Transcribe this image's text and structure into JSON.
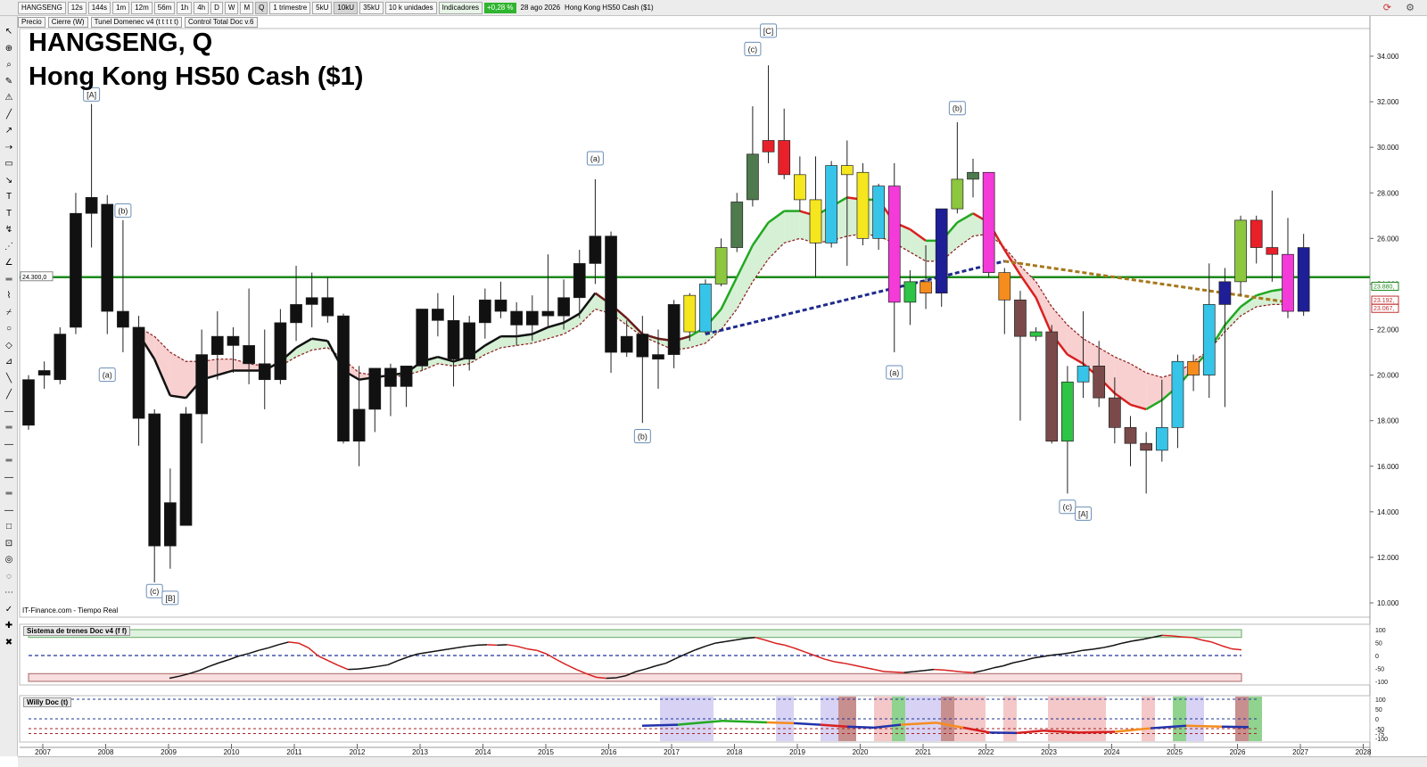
{
  "toolbar": {
    "symbol": "HANGSENG",
    "intervals": [
      "12s",
      "144s",
      "1m",
      "12m",
      "56m",
      "1h",
      "4h",
      "D",
      "W",
      "M",
      "Q"
    ],
    "selected_interval": "Q",
    "period": "1 trimestre",
    "unit_buttons": [
      "5kU",
      "10kU",
      "35kU"
    ],
    "selected_unit": "10kU",
    "units": "10 k unidades",
    "indicators": "Indicadores",
    "change": "+0,28 %",
    "date": "28 ago 2026",
    "instrument": "Hong Kong HS50 Cash ($1)"
  },
  "legend_chips": [
    "Precio",
    "Cierre (W)",
    "Tunel Domenec v4 (t t t t t)",
    "Control Total Doc v.6"
  ],
  "title_line1": "HANGSENG, Q",
  "title_line2": "Hong Kong HS50 Cash ($1)",
  "source": "IT-Finance.com - Tiempo Real",
  "panels": {
    "oscillator1": "Sistema de trenes Doc v4 (f f)",
    "oscillator2": "Willy Doc (t)"
  },
  "chart_data": {
    "type": "candlestick",
    "y_axis": {
      "ylim": [
        10000,
        36000
      ],
      "ticks": [
        "34.000",
        "32.000",
        "30.000",
        "28.000",
        "26.000",
        "24.000",
        "22.000",
        "20.000",
        "18.000",
        "16.000",
        "14.000",
        "12.000",
        "10.000"
      ],
      "tick_values": [
        34000,
        32000,
        30000,
        28000,
        26000,
        24000,
        22000,
        20000,
        18000,
        16000,
        14000,
        12000,
        10000
      ]
    },
    "x_axis": {
      "ticks": [
        "2007",
        "2008",
        "2009",
        "2010",
        "2011",
        "2012",
        "2013",
        "2014",
        "2015",
        "2016",
        "2017",
        "2018",
        "2019",
        "2020",
        "2021",
        "2022",
        "2023",
        "2024",
        "2025",
        "2026",
        "2027",
        "2028"
      ],
      "years": [
        2007,
        2008,
        2009,
        2010,
        2011,
        2012,
        2013,
        2014,
        2015,
        2016,
        2017,
        2018,
        2019,
        2020,
        2021,
        2022,
        2023,
        2024,
        2025,
        2026,
        2027,
        2028
      ]
    },
    "horizontal_line": {
      "value": 24300,
      "label": "24.300,0",
      "color": "#1c8a1c"
    },
    "price_labels": [
      {
        "value": 23880,
        "label": "23.880,",
        "color": "#1c8a1c"
      },
      {
        "value": 23192,
        "label": "23.192,",
        "color": "#c03030"
      },
      {
        "value": 23067,
        "label": "23.067,",
        "color": "#c03030"
      }
    ],
    "candles": [
      {
        "o": 19800,
        "h": 20000,
        "l": 17600,
        "c": 17800,
        "color": "#111111"
      },
      {
        "o": 20000,
        "h": 20600,
        "l": 19400,
        "c": 20200,
        "color": "#111111"
      },
      {
        "o": 19800,
        "h": 22100,
        "l": 19600,
        "c": 21800,
        "color": "#111111"
      },
      {
        "o": 22100,
        "h": 28000,
        "l": 21800,
        "c": 27100,
        "color": "#111111"
      },
      {
        "o": 27100,
        "h": 31900,
        "l": 25600,
        "c": 27800,
        "color": "#111111"
      },
      {
        "o": 27500,
        "h": 27900,
        "l": 21800,
        "c": 22800,
        "color": "#111111"
      },
      {
        "o": 22800,
        "h": 26800,
        "l": 21000,
        "c": 22100,
        "color": "#111111"
      },
      {
        "o": 22100,
        "h": 22600,
        "l": 16900,
        "c": 18100,
        "color": "#111111"
      },
      {
        "o": 18300,
        "h": 18500,
        "l": 10900,
        "c": 12500,
        "color": "#111111"
      },
      {
        "o": 12500,
        "h": 15900,
        "l": 11500,
        "c": 14400,
        "color": "#111111"
      },
      {
        "o": 13400,
        "h": 18600,
        "l": 13400,
        "c": 18300,
        "color": "#111111"
      },
      {
        "o": 18300,
        "h": 22000,
        "l": 17000,
        "c": 20900,
        "color": "#111111"
      },
      {
        "o": 20900,
        "h": 22800,
        "l": 19800,
        "c": 21700,
        "color": "#111111"
      },
      {
        "o": 21700,
        "h": 22100,
        "l": 20100,
        "c": 21300,
        "color": "#111111"
      },
      {
        "o": 21300,
        "h": 23800,
        "l": 19600,
        "c": 20500,
        "color": "#111111"
      },
      {
        "o": 20500,
        "h": 22000,
        "l": 18500,
        "c": 19800,
        "color": "#111111"
      },
      {
        "o": 19800,
        "h": 22900,
        "l": 19600,
        "c": 22300,
        "color": "#111111"
      },
      {
        "o": 22300,
        "h": 24800,
        "l": 21500,
        "c": 23100,
        "color": "#111111"
      },
      {
        "o": 23100,
        "h": 24500,
        "l": 22100,
        "c": 23400,
        "color": "#111111"
      },
      {
        "o": 23400,
        "h": 24300,
        "l": 22300,
        "c": 22600,
        "color": "#111111"
      },
      {
        "o": 22600,
        "h": 22700,
        "l": 17000,
        "c": 17100,
        "color": "#111111"
      },
      {
        "o": 17100,
        "h": 20400,
        "l": 16000,
        "c": 18500,
        "color": "#111111"
      },
      {
        "o": 18500,
        "h": 20300,
        "l": 17500,
        "c": 20300,
        "color": "#111111"
      },
      {
        "o": 20300,
        "h": 20500,
        "l": 18200,
        "c": 19500,
        "color": "#111111"
      },
      {
        "o": 19500,
        "h": 20400,
        "l": 18600,
        "c": 20400,
        "color": "#111111"
      },
      {
        "o": 20400,
        "h": 22900,
        "l": 20200,
        "c": 22900,
        "color": "#111111"
      },
      {
        "o": 22900,
        "h": 23600,
        "l": 21700,
        "c": 22400,
        "color": "#111111"
      },
      {
        "o": 22400,
        "h": 23500,
        "l": 19500,
        "c": 20700,
        "color": "#111111"
      },
      {
        "o": 20700,
        "h": 22600,
        "l": 20200,
        "c": 22300,
        "color": "#111111"
      },
      {
        "o": 22300,
        "h": 23800,
        "l": 21600,
        "c": 23300,
        "color": "#111111"
      },
      {
        "o": 23300,
        "h": 24100,
        "l": 22500,
        "c": 22800,
        "color": "#111111"
      },
      {
        "o": 22800,
        "h": 23200,
        "l": 21300,
        "c": 22200,
        "color": "#111111"
      },
      {
        "o": 22200,
        "h": 23500,
        "l": 21500,
        "c": 22800,
        "color": "#111111"
      },
      {
        "o": 22800,
        "h": 25300,
        "l": 22100,
        "c": 22600,
        "color": "#111111"
      },
      {
        "o": 22600,
        "h": 24200,
        "l": 22000,
        "c": 23400,
        "color": "#111111"
      },
      {
        "o": 23400,
        "h": 25500,
        "l": 22500,
        "c": 24900,
        "color": "#111111"
      },
      {
        "o": 24900,
        "h": 28600,
        "l": 24000,
        "c": 26100,
        "color": "#111111"
      },
      {
        "o": 26100,
        "h": 26300,
        "l": 20100,
        "c": 21000,
        "color": "#111111"
      },
      {
        "o": 21700,
        "h": 22400,
        "l": 20800,
        "c": 21000,
        "color": "#111111"
      },
      {
        "o": 21800,
        "h": 22600,
        "l": 17900,
        "c": 20800,
        "color": "#111111"
      },
      {
        "o": 20700,
        "h": 22000,
        "l": 19400,
        "c": 20900,
        "color": "#111111"
      },
      {
        "o": 20900,
        "h": 23300,
        "l": 20300,
        "c": 23100,
        "color": "#111111"
      },
      {
        "o": 21900,
        "h": 23600,
        "l": 21500,
        "c": 23500,
        "color": "#f5e61e"
      },
      {
        "o": 21900,
        "h": 24200,
        "l": 21800,
        "c": 24000,
        "color": "#36c5e8"
      },
      {
        "o": 24000,
        "h": 26000,
        "l": 23900,
        "c": 25600,
        "color": "#8dc63f"
      },
      {
        "o": 25600,
        "h": 28000,
        "l": 25400,
        "c": 27600,
        "color": "#4e7a4e"
      },
      {
        "o": 27700,
        "h": 31800,
        "l": 27400,
        "c": 29700,
        "color": "#4e7a4e"
      },
      {
        "o": 29800,
        "h": 33600,
        "l": 29300,
        "c": 30300,
        "color": "#e8202a"
      },
      {
        "o": 30300,
        "h": 31700,
        "l": 28600,
        "c": 28800,
        "color": "#e8202a"
      },
      {
        "o": 28800,
        "h": 29600,
        "l": 27200,
        "c": 27700,
        "color": "#f5e61e"
      },
      {
        "o": 27700,
        "h": 29600,
        "l": 24300,
        "c": 25800,
        "color": "#f5e61e"
      },
      {
        "o": 25800,
        "h": 29400,
        "l": 25600,
        "c": 29200,
        "color": "#36c5e8"
      },
      {
        "o": 29200,
        "h": 30300,
        "l": 24800,
        "c": 28800,
        "color": "#f5e61e"
      },
      {
        "o": 28900,
        "h": 29300,
        "l": 25700,
        "c": 26000,
        "color": "#f5e61e"
      },
      {
        "o": 26000,
        "h": 28400,
        "l": 25500,
        "c": 28300,
        "color": "#36c5e8"
      },
      {
        "o": 28300,
        "h": 29300,
        "l": 21000,
        "c": 23200,
        "color": "#f43ad8"
      },
      {
        "o": 23200,
        "h": 24600,
        "l": 22200,
        "c": 24100,
        "color": "#2ec445"
      },
      {
        "o": 24100,
        "h": 25700,
        "l": 22900,
        "c": 23600,
        "color": "#f68c1e"
      },
      {
        "o": 23600,
        "h": 27300,
        "l": 23000,
        "c": 27300,
        "color": "#1e1e96"
      },
      {
        "o": 27300,
        "h": 31100,
        "l": 27100,
        "c": 28600,
        "color": "#8dc63f"
      },
      {
        "o": 28600,
        "h": 29500,
        "l": 27800,
        "c": 28900,
        "color": "#4e7a4e"
      },
      {
        "o": 28900,
        "h": 28900,
        "l": 24300,
        "c": 24500,
        "color": "#f43ad8"
      },
      {
        "o": 24500,
        "h": 24700,
        "l": 21800,
        "c": 23300,
        "color": "#f68c1e"
      },
      {
        "o": 23300,
        "h": 23700,
        "l": 18000,
        "c": 21700,
        "color": "#7a4a4a"
      },
      {
        "o": 21700,
        "h": 22100,
        "l": 21500,
        "c": 21900,
        "color": "#2ec445"
      },
      {
        "o": 21900,
        "h": 22200,
        "l": 17000,
        "c": 17100,
        "color": "#7a4a4a"
      },
      {
        "o": 17100,
        "h": 20400,
        "l": 14800,
        "c": 19700,
        "color": "#2ec445"
      },
      {
        "o": 19700,
        "h": 22800,
        "l": 19000,
        "c": 20400,
        "color": "#36c5e8"
      },
      {
        "o": 20400,
        "h": 21500,
        "l": 18600,
        "c": 19000,
        "color": "#7a4a4a"
      },
      {
        "o": 19000,
        "h": 19900,
        "l": 17000,
        "c": 17700,
        "color": "#7a4a4a"
      },
      {
        "o": 17700,
        "h": 18200,
        "l": 16000,
        "c": 17000,
        "color": "#7a4a4a"
      },
      {
        "o": 17000,
        "h": 17500,
        "l": 14800,
        "c": 16700,
        "color": "#7a4a4a"
      },
      {
        "o": 16700,
        "h": 19800,
        "l": 16200,
        "c": 17700,
        "color": "#36c5e8"
      },
      {
        "o": 17700,
        "h": 20900,
        "l": 16800,
        "c": 20600,
        "color": "#36c5e8"
      },
      {
        "o": 20000,
        "h": 20900,
        "l": 19300,
        "c": 20600,
        "color": "#f68c1e"
      },
      {
        "o": 20000,
        "h": 24900,
        "l": 19000,
        "c": 23100,
        "color": "#36c5e8"
      },
      {
        "o": 23100,
        "h": 24700,
        "l": 18600,
        "c": 24100,
        "color": "#1e1e96"
      },
      {
        "o": 24100,
        "h": 27000,
        "l": 23500,
        "c": 26800,
        "color": "#8dc63f"
      },
      {
        "o": 26800,
        "h": 27000,
        "l": 24900,
        "c": 25600,
        "color": "#e8202a"
      },
      {
        "o": 25600,
        "h": 28100,
        "l": 24100,
        "c": 25300,
        "color": "#e8202a"
      },
      {
        "o": 25300,
        "h": 26900,
        "l": 22500,
        "c": 22800,
        "color": "#f43ad8"
      },
      {
        "o": 22800,
        "h": 26200,
        "l": 22600,
        "c": 25600,
        "color": "#1e1e96"
      }
    ],
    "ma_fast": [
      null,
      null,
      null,
      null,
      null,
      null,
      null,
      21800,
      20700,
      19100,
      19000,
      19800,
      20000,
      20200,
      20200,
      20200,
      20600,
      21200,
      21600,
      21500,
      20200,
      19800,
      19900,
      20000,
      20100,
      20600,
      20800,
      20600,
      20800,
      21300,
      21700,
      21700,
      21800,
      22100,
      22300,
      22700,
      23600,
      23100,
      22500,
      21800,
      21600,
      21500,
      21700,
      22100,
      22900,
      24300,
      25700,
      26700,
      27200,
      27200,
      27000,
      27400,
      27800,
      27700,
      27700,
      26700,
      26400,
      25900,
      25900,
      26700,
      27100,
      26700,
      25500,
      24400,
      23400,
      21800,
      20900,
      20500,
      19900,
      19200,
      18700,
      18500,
      18900,
      19500,
      20300,
      21100,
      22200,
      23000,
      23500,
      23700,
      23800
    ],
    "ma_slow": [
      null,
      null,
      null,
      null,
      null,
      null,
      null,
      22100,
      21700,
      21000,
      20600,
      20600,
      20700,
      20700,
      20500,
      20400,
      20400,
      20800,
      21100,
      21200,
      20700,
      20100,
      20000,
      19900,
      20000,
      20200,
      20500,
      20400,
      20500,
      20900,
      21200,
      21300,
      21400,
      21600,
      21800,
      22200,
      22900,
      22700,
      22200,
      21700,
      21400,
      21100,
      21200,
      21400,
      22000,
      22900,
      24100,
      25100,
      25800,
      26000,
      25800,
      25900,
      26100,
      26200,
      26100,
      25800,
      25400,
      25000,
      25000,
      25600,
      26100,
      26200,
      25600,
      24800,
      24100,
      23000,
      22200,
      21600,
      21200,
      20800,
      20500,
      20100,
      19900,
      20100,
      20600,
      21100,
      21900,
      22600,
      23000,
      23100,
      23100
    ],
    "ma_slow_color": "#8b1a1a",
    "trend_dashed_blue": {
      "from_index": 43,
      "to_index": 62,
      "from_value": 21800,
      "to_value": 25000,
      "color": "#1e2a8c"
    },
    "trend_dashed_gold": {
      "from_index": 62,
      "to_index": 80,
      "from_value": 25000,
      "to_value": 23200,
      "color": "#a6771a"
    },
    "annotations": [
      {
        "i": 4,
        "v": 32300,
        "text": "[A]"
      },
      {
        "i": 6,
        "v": 27200,
        "text": "(b)"
      },
      {
        "i": 5,
        "v": 20000,
        "text": "(a)"
      },
      {
        "i": 8,
        "v": 10500,
        "text": "(c)"
      },
      {
        "i": 9,
        "v": 10200,
        "text": "[B]"
      },
      {
        "i": 36,
        "v": 29500,
        "text": "(a)"
      },
      {
        "i": 39,
        "v": 17300,
        "text": "(b)"
      },
      {
        "i": 46,
        "v": 34300,
        "text": "(c)"
      },
      {
        "i": 47,
        "v": 35100,
        "text": "[C]"
      },
      {
        "i": 55,
        "v": 20100,
        "text": "(a)"
      },
      {
        "i": 59,
        "v": 31700,
        "text": "(b)"
      },
      {
        "i": 66,
        "v": 14200,
        "text": "(c)"
      },
      {
        "i": 67,
        "v": 13900,
        "text": "[A]"
      }
    ],
    "osc1": {
      "ylim": [
        -100,
        100
      ],
      "ticks": [
        "100",
        "50",
        "0",
        "-50",
        "-100"
      ],
      "tick_values": [
        100,
        50,
        0,
        -50,
        -100
      ],
      "values": [
        null,
        null,
        null,
        null,
        null,
        null,
        null,
        -88,
        -80,
        -70,
        -58,
        -42,
        -28,
        -16,
        -2,
        8,
        20,
        30,
        42,
        52,
        48,
        30,
        -2,
        -20,
        -38,
        -54,
        -52,
        -48,
        -42,
        -36,
        -20,
        -6,
        6,
        12,
        18,
        24,
        30,
        36,
        40,
        42,
        40,
        42,
        36,
        26,
        20,
        6,
        -16,
        -36,
        -54,
        -70,
        -84,
        -88,
        -86,
        -78,
        -62,
        -52,
        -40,
        -30,
        -12,
        6,
        22,
        36,
        48,
        54,
        60,
        66,
        70,
        60,
        48,
        40,
        28,
        14,
        0,
        -14,
        -24,
        -30,
        -38,
        -46,
        -54,
        -62,
        -64,
        -66,
        -62,
        -58,
        -54,
        -56,
        -60,
        -64,
        -66,
        -58,
        -48,
        -40,
        -28,
        -20,
        -10,
        -4,
        2,
        6,
        12,
        20,
        24,
        30,
        38,
        48,
        56,
        62,
        70,
        78,
        76,
        72,
        70,
        60,
        52,
        38,
        26,
        22
      ]
    },
    "osc2": {
      "ylim": [
        -100,
        100
      ],
      "ticks": [
        "100",
        "50",
        "0",
        "-50",
        "-75",
        "-100"
      ],
      "tick_values": [
        100,
        50,
        0,
        -50,
        -75,
        -100
      ]
    }
  }
}
